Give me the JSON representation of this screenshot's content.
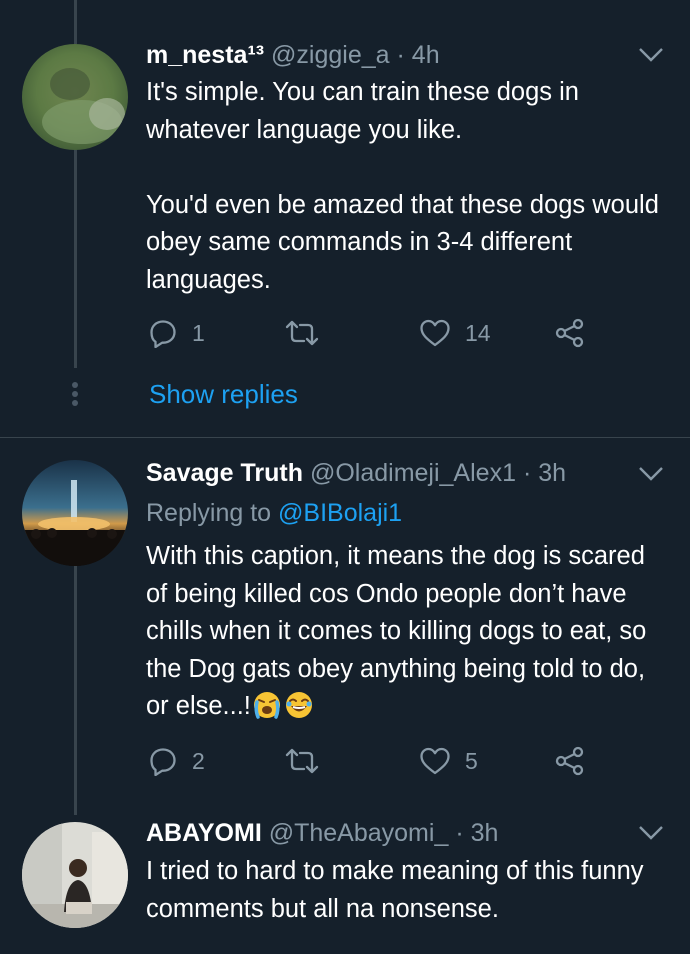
{
  "tweets": [
    {
      "display_name": "m_nesta¹³",
      "handle": "@ziggie_a",
      "separator": "·",
      "time": "4h",
      "body": [
        "It's simple. You can train these dogs in whatever language you like.",
        "You'd even be amazed that these dogs would obey same commands in 3-4 different languages."
      ],
      "reply_count": "1",
      "retweet_count": "",
      "like_count": "14"
    },
    {
      "display_name": "Savage Truth",
      "handle": "@Oladimeji_Alex1",
      "separator": "·",
      "time": "3h",
      "replying_prefix": "Replying to",
      "replying_to": "@BIBolaji1",
      "body": [
        "With this caption, it means the dog is scared of being killed cos Ondo people don’t have chills when it comes to killing dogs to eat, so the Dog gats obey anything being told to do, or else...!"
      ],
      "reply_count": "2",
      "retweet_count": "",
      "like_count": "5"
    },
    {
      "display_name": "ABAYOMI",
      "handle": "@TheAbayomi_",
      "separator": "·",
      "time": "3h",
      "body": [
        "I tried to hard to make meaning of this funny comments but all na nonsense."
      ]
    }
  ],
  "show_replies_label": "Show replies",
  "icons": [
    "reply-icon",
    "retweet-icon",
    "like-icon",
    "share-icon",
    "chevron-down-icon",
    "crying-emoji",
    "laughing-emoji"
  ],
  "colors": {
    "background": "#15202b",
    "text": "#ffffff",
    "secondary": "#8899a6",
    "link": "#1da1f2",
    "line": "#38444d"
  }
}
